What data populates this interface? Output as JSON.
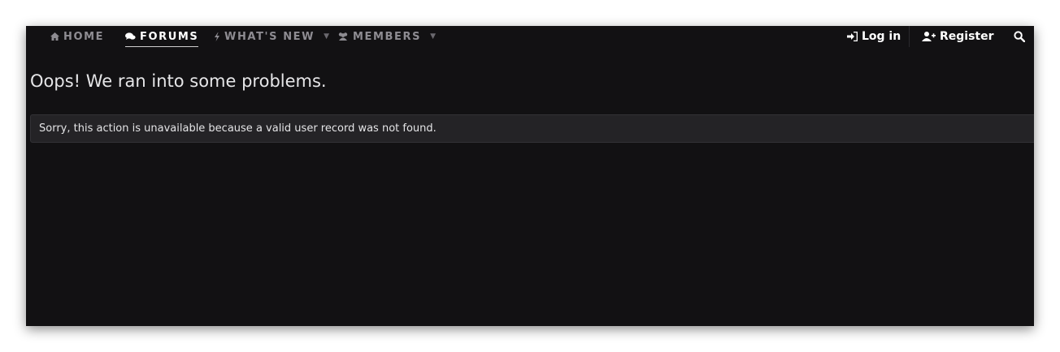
{
  "nav": {
    "items": [
      {
        "label": "HOME",
        "icon": "home-icon"
      },
      {
        "label": "FORUMS",
        "icon": "comments-icon",
        "active": true
      },
      {
        "label": "WHAT'S NEW",
        "icon": "bolt-icon",
        "dropdown": true
      },
      {
        "label": "MEMBERS",
        "icon": "users-icon",
        "dropdown": true
      }
    ],
    "login_label": "Log in",
    "register_label": "Register",
    "search_icon": "search-icon"
  },
  "page": {
    "title": "Oops! We ran into some problems.",
    "message": "Sorry, this action is unavailable because a valid user record was not found."
  },
  "colors": {
    "background": "#121113",
    "notice_bg": "#242326",
    "nav_inactive": "#8e8c92",
    "nav_active": "#ffffff"
  }
}
